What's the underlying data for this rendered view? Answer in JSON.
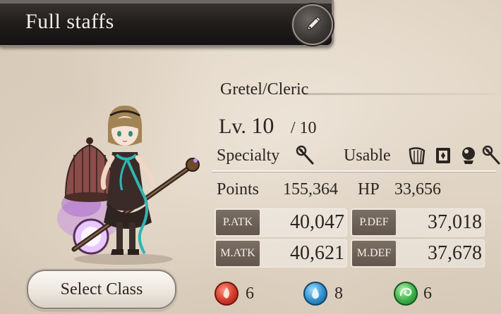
{
  "header": {
    "title": "Full staffs",
    "edit_icon": "pen-nib-icon"
  },
  "character": {
    "name": "Gretel/Cleric",
    "level_prefix": "Lv.",
    "level": "10",
    "level_max": "/ 10",
    "specialty_label": "Specialty",
    "specialty_icon": "staff-icon",
    "usable_label": "Usable",
    "usable_icons": [
      "harp-icon",
      "tome-icon",
      "orb-icon",
      "staff-icon"
    ]
  },
  "stats": {
    "points_label": "Points",
    "points": "155,364",
    "hp_label": "HP",
    "hp": "33,656",
    "patk_label": "P.ATK",
    "patk": "40,047",
    "pdef_label": "P.DEF",
    "pdef": "37,018",
    "matk_label": "M.ATK",
    "matk": "40,621",
    "mdef_label": "M.DEF",
    "mdef": "37,678"
  },
  "elements": {
    "fire_icon": "fire-orb-icon",
    "fire": "6",
    "water_icon": "water-orb-icon",
    "water": "8",
    "wind_icon": "wind-orb-icon",
    "wind": "6"
  },
  "actions": {
    "select_class": "Select Class"
  },
  "colors": {
    "title_bar": "#1f1c1b",
    "stat_tag": "#6e6158",
    "fire": "#c9352a",
    "water": "#2d8fc9",
    "wind": "#3ab04a"
  }
}
